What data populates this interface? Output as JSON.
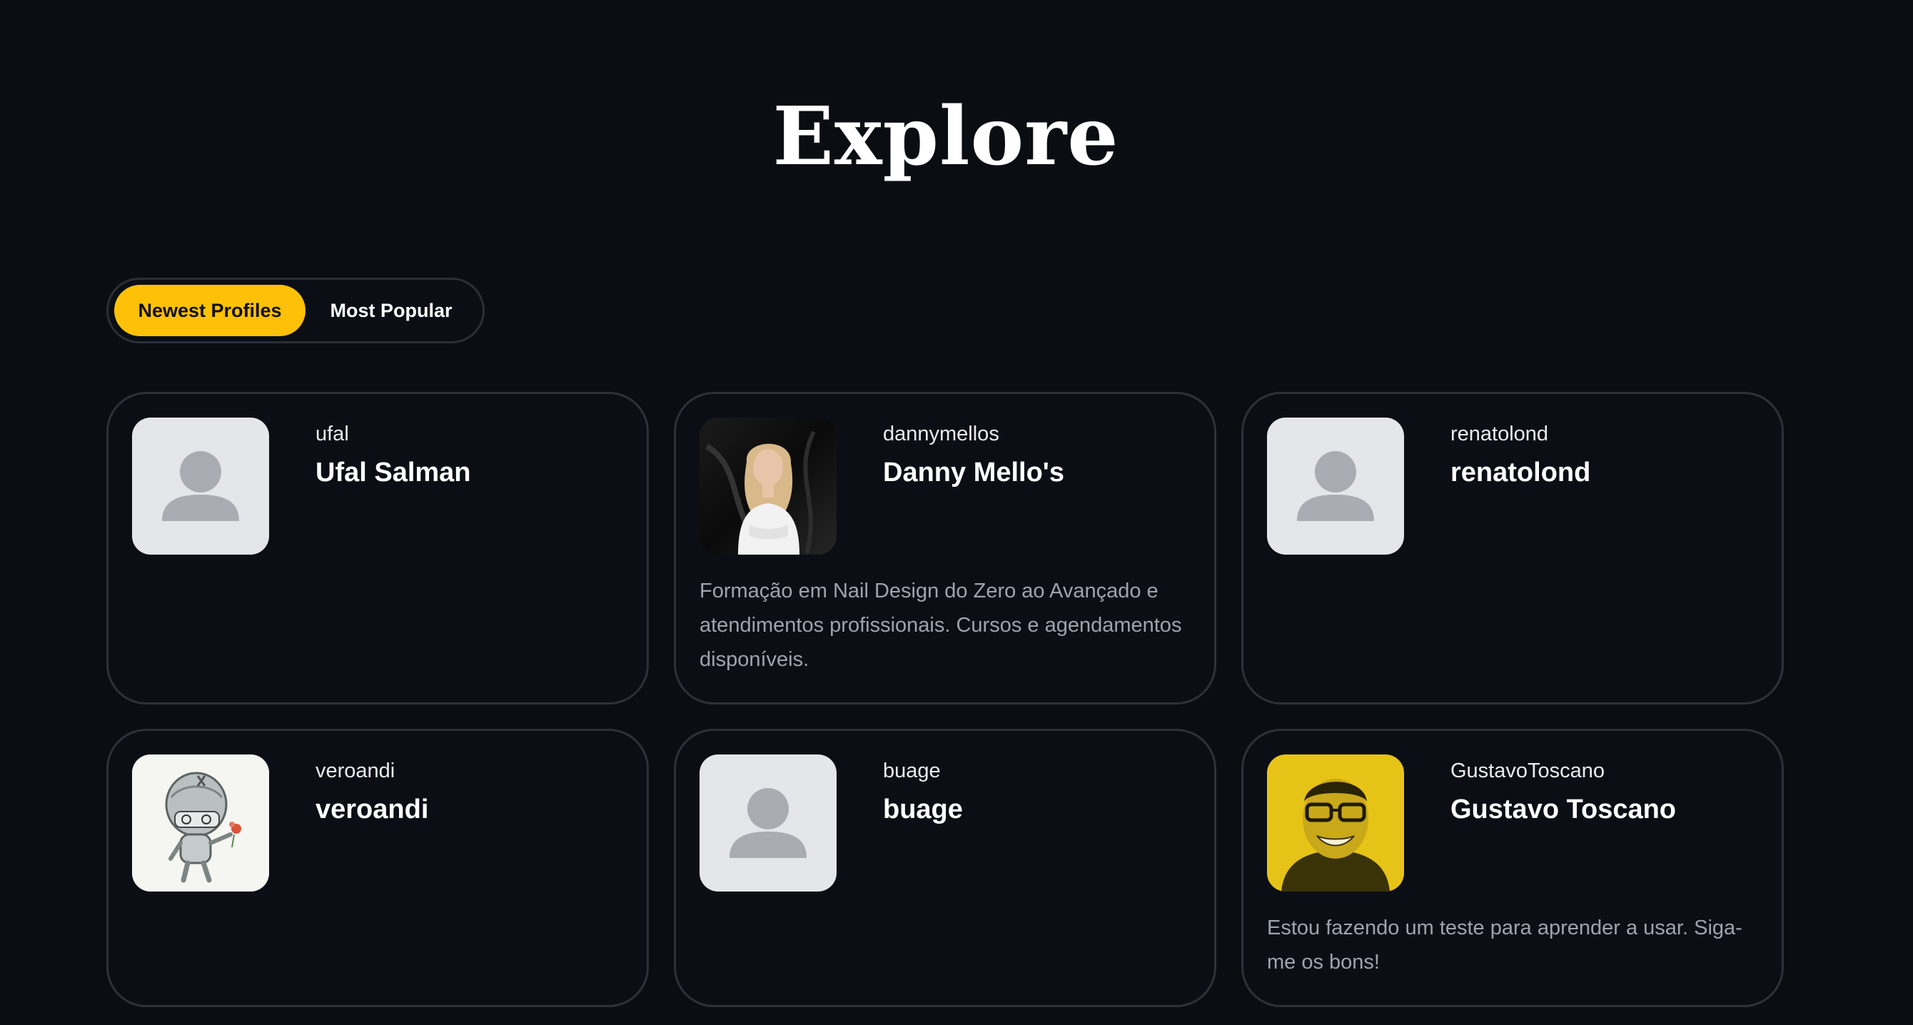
{
  "header": {
    "title": "Explore"
  },
  "tabs": [
    {
      "label": "Newest Profiles",
      "active": true
    },
    {
      "label": "Most Popular",
      "active": false
    }
  ],
  "colors": {
    "background": "#0a0d12",
    "accent": "#ffc107",
    "card_border": "#2e3137",
    "muted_text": "#9ea4ad"
  },
  "profiles": [
    {
      "username": "ufal",
      "display_name": "Ufal Salman",
      "bio": "",
      "avatar": "default-user-icon"
    },
    {
      "username": "dannymellos",
      "display_name": "Danny Mello's",
      "bio": "Formação em Nail Design do Zero ao Avançado e atendimentos profissionais. Cursos e agendamentos disponíveis.",
      "avatar": "woman-portrait-photo"
    },
    {
      "username": "renatolond",
      "display_name": "renatolond",
      "bio": "",
      "avatar": "default-user-icon"
    },
    {
      "username": "veroandi",
      "display_name": "veroandi",
      "bio": "",
      "avatar": "robot-drawing"
    },
    {
      "username": "buage",
      "display_name": "buage",
      "bio": "",
      "avatar": "default-user-icon"
    },
    {
      "username": "GustavoToscano",
      "display_name": "Gustavo Toscano",
      "bio": "Estou fazendo um teste para aprender a usar. Siga-me os bons!",
      "avatar": "man-portrait-photo"
    }
  ]
}
